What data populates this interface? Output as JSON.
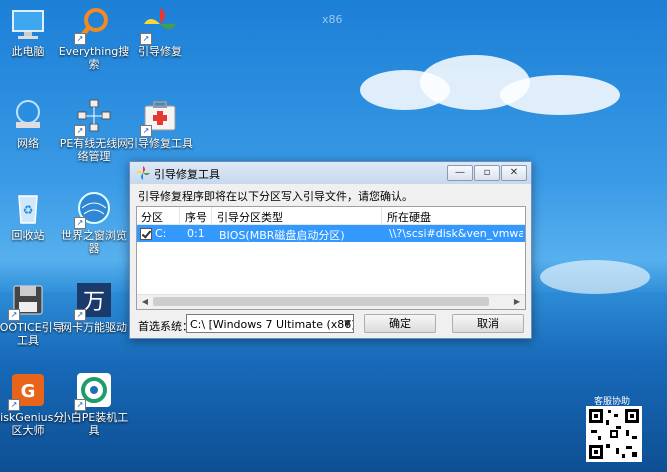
{
  "desktop": {
    "watermark": "x86",
    "icons": [
      {
        "label": "此电脑",
        "icon": "computer-icon"
      },
      {
        "label": "Everything搜索",
        "icon": "search-icon"
      },
      {
        "label": "引导修复",
        "icon": "pinwheel-icon"
      },
      {
        "label": "网络",
        "icon": "network-icon"
      },
      {
        "label": "PE有线无线网络管理",
        "icon": "network-manager-icon"
      },
      {
        "label": "引导修复工具",
        "icon": "repair-kit-icon"
      },
      {
        "label": "回收站",
        "icon": "recycle-bin-icon"
      },
      {
        "label": "世界之窗浏览器",
        "icon": "globe-browser-icon"
      },
      {
        "label": "BOOTICE引导工具",
        "icon": "floppy-icon"
      },
      {
        "label": "网卡万能驱动",
        "icon": "wan-driver-icon"
      },
      {
        "label": "DiskGenius分区大师",
        "icon": "diskgenius-icon"
      },
      {
        "label": "小白PE装机工具",
        "icon": "installer-icon"
      }
    ],
    "qr_label": "客服协助"
  },
  "dialog": {
    "title": "引导修复工具",
    "controls": {
      "minimize": "—",
      "restore": "▫",
      "close": "✕"
    },
    "prompt": "引导修复程序即将在以下分区写入引导文件，请您确认。",
    "columns": [
      "分区",
      "序号",
      "引导分区类型",
      "所在硬盘"
    ],
    "rows": [
      {
        "checked": true,
        "partition": "C:",
        "index": "0:1",
        "type": "BIOS(MBR磁盘启动分区)",
        "disk": "\\\\?\\scsi#disk&ven_vmware_&"
      }
    ],
    "first_system_label": "首选系统：",
    "first_system_value": "C:\\ [Windows 7 Ultimate (x86)]",
    "ok_label": "确定",
    "cancel_label": "取消"
  },
  "colors": {
    "selection": "#3399ff",
    "accent": "#1c7fd6"
  }
}
